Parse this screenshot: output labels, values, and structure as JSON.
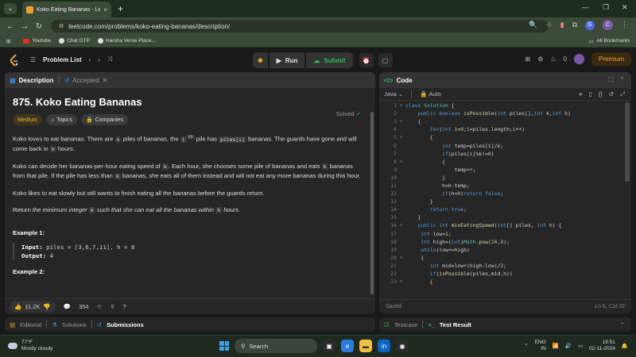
{
  "browser": {
    "tab_title": "Koko Eating Bananas - LeetCode",
    "tab_close": "×",
    "new_tab": "+",
    "url": "leetcode.com/problems/koko-eating-bananas/description/",
    "bookmarks": [
      "Youtube",
      "Chat GTP",
      "Harsha Verse Place..."
    ],
    "all_bookmarks": "All Bookmarks",
    "ext_g": "G",
    "ext_c": "C"
  },
  "lcnav": {
    "problem_list": "Problem List",
    "run": "Run",
    "submit": "Submit",
    "streak": "0",
    "premium": "Premium"
  },
  "description": {
    "tab_description": "Description",
    "tab_accepted": "Accepted",
    "title": "875. Koko Eating Bananas",
    "solved": "Solved",
    "tags": {
      "difficulty": "Medium",
      "topics": "Topics",
      "companies": "Companies"
    },
    "p1": [
      "Koko loves to eat bananas. There are ",
      "n",
      " piles of bananas, the ",
      "i",
      "th",
      " pile has ",
      "piles[i]",
      " bananas. The guards have gone and will come back in ",
      "h",
      " hours."
    ],
    "p2": [
      "Koko can decide her bananas-per-hour eating speed of ",
      "k",
      ". Each hour, she chooses some pile of bananas and eats ",
      "k",
      " bananas from that pile. If the pile has less than ",
      "k",
      " bananas, she eats all of them instead and will not eat any more bananas during this hour."
    ],
    "p3": "Koko likes to eat slowly but still wants to finish eating all the bananas before the guards return.",
    "p4": [
      "Return ",
      "the minimum integer ",
      "k",
      " such that she can eat all the bananas within ",
      "h",
      " hours",
      "."
    ],
    "example1_title": "Example 1:",
    "example1_input_label": "Input:",
    "example1_input": " piles = [3,6,7,11], h = 8",
    "example1_output_label": "Output:",
    "example1_output": " 4",
    "example2_title": "Example 2:",
    "likes": "11.2K",
    "comments": "354"
  },
  "code": {
    "title": "Code",
    "language": "Java",
    "mode": "Auto",
    "status": "Saved",
    "cursor": "Ln 6, Col 22",
    "lines": [
      {
        "n": "1",
        "fold": "v",
        "t": "class Solution {"
      },
      {
        "n": "2",
        "fold": "",
        "t": "    public boolean isPossible(int piles[],int k,int h)"
      },
      {
        "n": "3",
        "fold": "v",
        "t": "    {"
      },
      {
        "n": "4",
        "fold": "",
        "t": "        for(int i=0;i<piles.length;i++)"
      },
      {
        "n": "5",
        "fold": "v",
        "t": "        {"
      },
      {
        "n": "6",
        "fold": "",
        "t": "            int temp=piles[i]/k;"
      },
      {
        "n": "7",
        "fold": "",
        "t": "            if(piles[i]%k!=0)"
      },
      {
        "n": "8",
        "fold": "v",
        "t": "            {"
      },
      {
        "n": "9",
        "fold": "",
        "t": "                temp++;"
      },
      {
        "n": "10",
        "fold": "",
        "t": "            }"
      },
      {
        "n": "11",
        "fold": "",
        "t": "            h=h-temp;"
      },
      {
        "n": "12",
        "fold": "",
        "t": "            if(h<0)return false;"
      },
      {
        "n": "13",
        "fold": "",
        "t": "        }"
      },
      {
        "n": "14",
        "fold": "",
        "t": "        return true;"
      },
      {
        "n": "15",
        "fold": "",
        "t": "    }"
      },
      {
        "n": "16",
        "fold": "v",
        "t": "    public int minEatingSpeed(int[] piles, int h) {"
      },
      {
        "n": "17",
        "fold": "",
        "t": "     int low=1;"
      },
      {
        "n": "18",
        "fold": "",
        "t": "     int high=(int)Math.pow(10,9);"
      },
      {
        "n": "19",
        "fold": "",
        "t": "     while(low<=high)"
      },
      {
        "n": "20",
        "fold": "v",
        "t": "     {"
      },
      {
        "n": "21",
        "fold": "",
        "t": "        int mid=low+(high-low)/2;"
      },
      {
        "n": "22",
        "fold": "",
        "t": "        if(isPossible(piles,mid,h))"
      },
      {
        "n": "23",
        "fold": "v",
        "t": "        {"
      }
    ]
  },
  "bottom": {
    "editorial": "Editorial",
    "solutions": "Solutions",
    "submissions": "Submissions",
    "testcase": "Testcase",
    "test_result": "Test Result"
  },
  "taskbar": {
    "temp": "77°F",
    "weather": "Mostly cloudy",
    "search": "Search",
    "lang1": "ENG",
    "lang2": "IN",
    "time": "19:51",
    "date": "02-11-2024"
  }
}
